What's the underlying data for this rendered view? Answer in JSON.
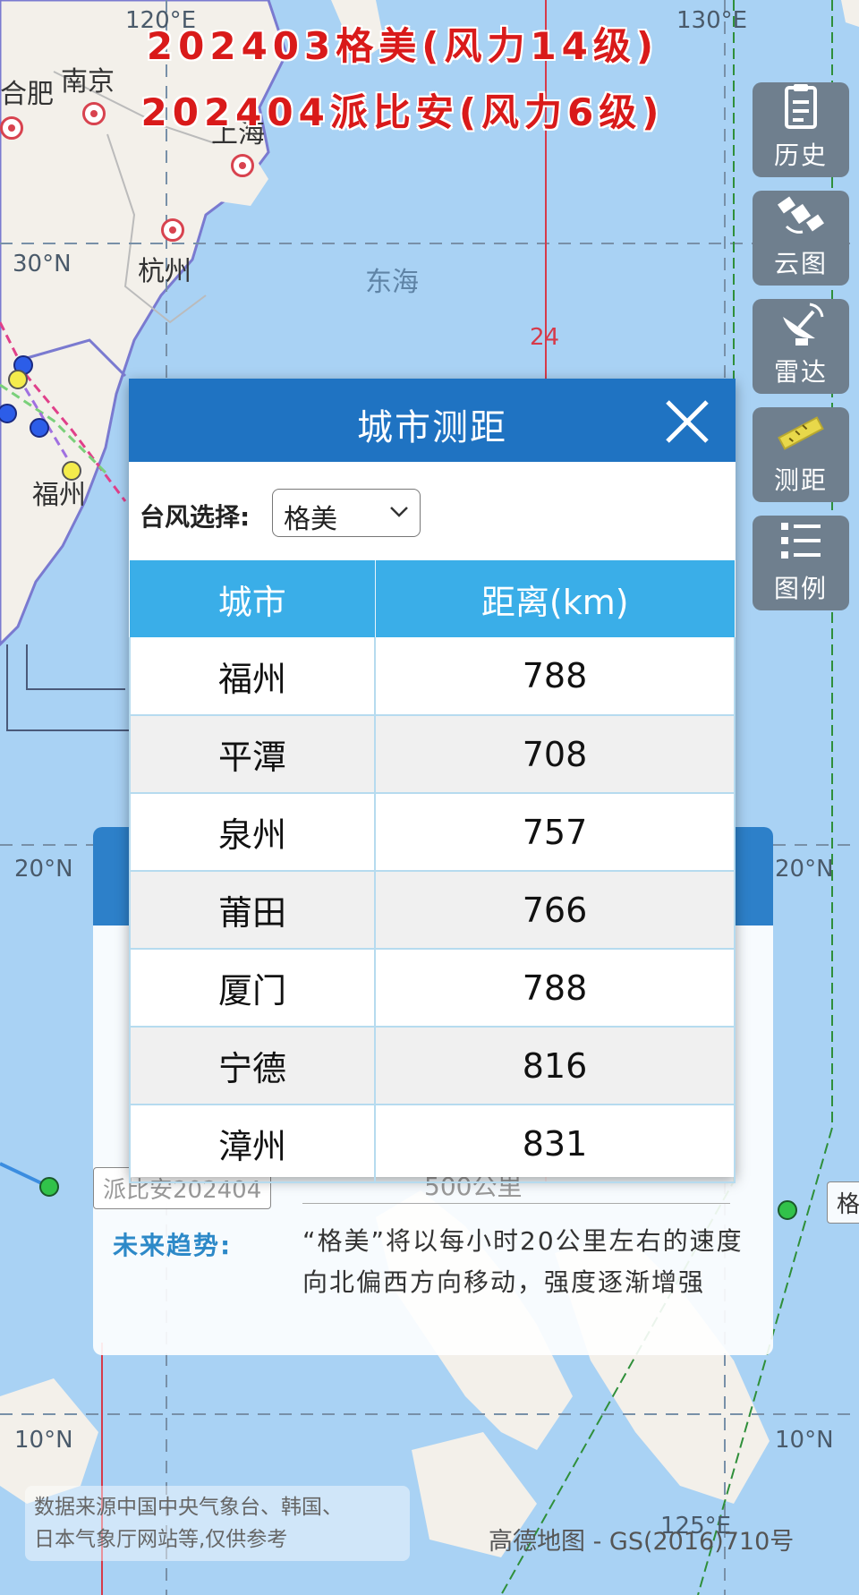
{
  "title": {
    "line1": "202403格美(风力14级)",
    "line2": "202404派比安(风力6级)"
  },
  "map": {
    "cities": {
      "hefei": "合肥",
      "nanjing": "南京",
      "shanghai": "上海",
      "hangzhou": "杭州",
      "fuzhou": "福州"
    },
    "sea": "东海",
    "latitudes": {
      "lat30": "30°N",
      "lat20_left": "20°N",
      "lat20_right": "20°N",
      "lat10_left": "10°N",
      "lat10_right": "10°N"
    },
    "longitudes": {
      "lon120": "120°E",
      "lon130": "130°E",
      "lon125": "125°E"
    },
    "line_label_24": "24",
    "colors": {
      "sea": "#a9d2f4",
      "land": "#f3f0ea",
      "forecast_line": "#d63a4a",
      "warning_line": "#2f8f3a"
    }
  },
  "tools": [
    {
      "label": "历史",
      "icon": "clipboard-icon"
    },
    {
      "label": "云图",
      "icon": "satellite-icon"
    },
    {
      "label": "雷达",
      "icon": "radar-dish-icon"
    },
    {
      "label": "测距",
      "icon": "ruler-icon"
    },
    {
      "label": "图例",
      "icon": "legend-list-icon"
    }
  ],
  "track_tags": {
    "left": "派比安202404",
    "right": "格"
  },
  "info_panel": {
    "distance_value": "500公里",
    "trend_label": "未来趋势:",
    "trend_text": "“格美”将以每小时20公里左右的速度向北偏西方向移动，强度逐渐增强"
  },
  "dialog": {
    "title": "城市测距",
    "typhoon_select_label": "台风选择:",
    "typhoon_select_value": "格美",
    "columns": [
      "城市",
      "距离(km)"
    ],
    "rows": [
      {
        "city": "福州",
        "distance": "788"
      },
      {
        "city": "平潭",
        "distance": "708"
      },
      {
        "city": "泉州",
        "distance": "757"
      },
      {
        "city": "莆田",
        "distance": "766"
      },
      {
        "city": "厦门",
        "distance": "788"
      },
      {
        "city": "宁德",
        "distance": "816"
      },
      {
        "city": "漳州",
        "distance": "831"
      }
    ]
  },
  "footer": {
    "source_line1": "数据来源中国中央气象台、韩国、",
    "source_line2": "日本气象厅网站等,仅供参考",
    "copyright": "高德地图 - GS(2016)710号"
  }
}
